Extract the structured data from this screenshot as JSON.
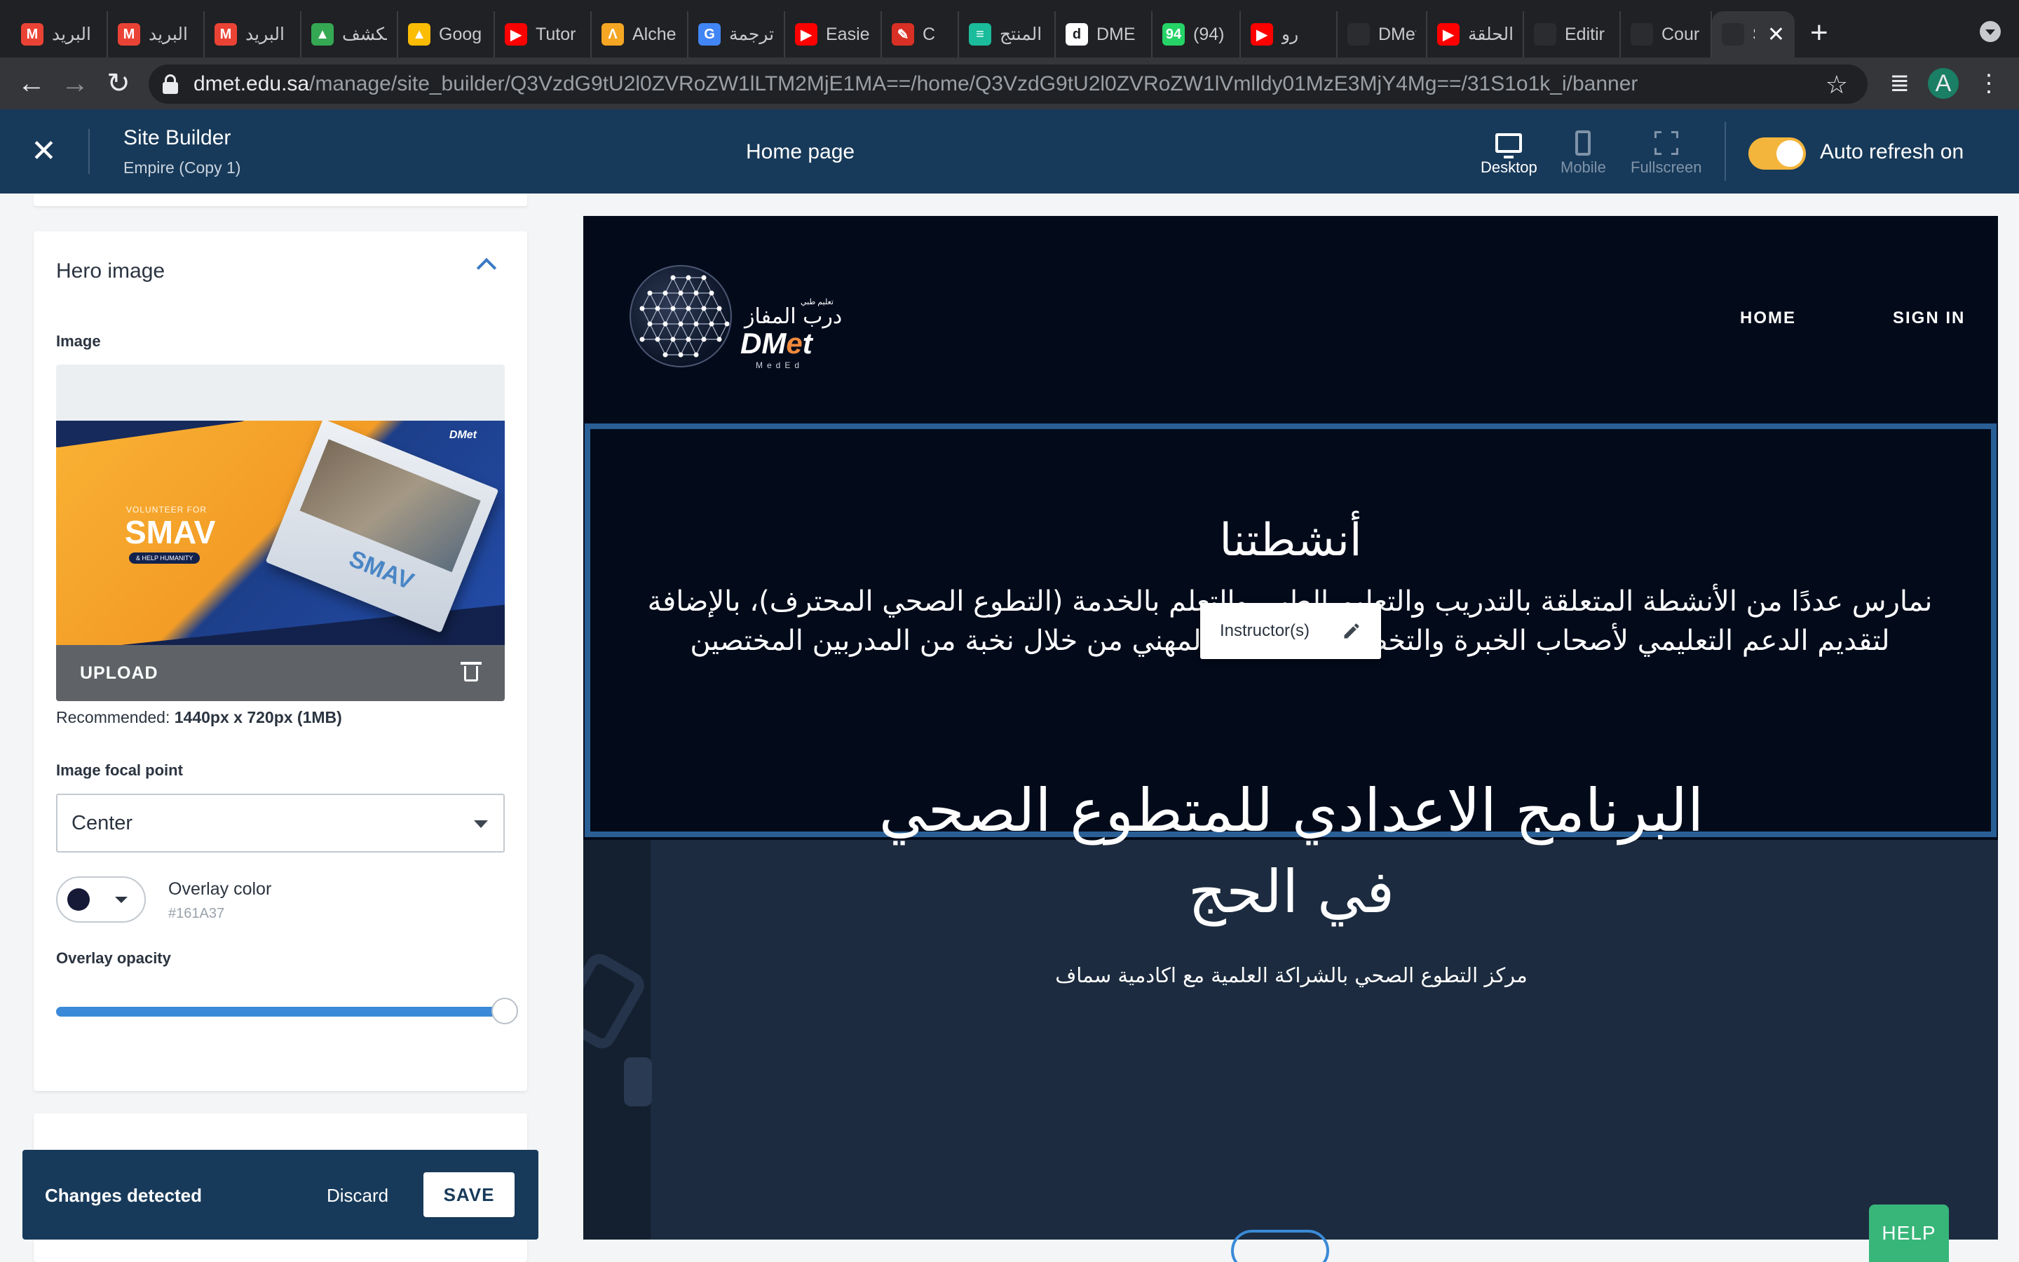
{
  "browser": {
    "tabs": [
      {
        "title": "البريد",
        "icon": "gmail-icon",
        "color": "#ea4335",
        "glyph": "M"
      },
      {
        "title": "البريد",
        "icon": "gmail-icon",
        "color": "#ea4335",
        "glyph": "M"
      },
      {
        "title": "البريد",
        "icon": "gmail-icon",
        "color": "#ea4335",
        "glyph": "M"
      },
      {
        "title": "الكشف",
        "icon": "drive-icon",
        "color": "#34a853",
        "glyph": "▲"
      },
      {
        "title": "Goog",
        "icon": "drive-icon",
        "color": "#fbbc04",
        "glyph": "▲"
      },
      {
        "title": "Tutor",
        "icon": "youtube-icon",
        "color": "#ff0000",
        "glyph": "▶"
      },
      {
        "title": "Alche",
        "icon": "alchemy-icon",
        "color": "#f5a623",
        "glyph": "Λ"
      },
      {
        "title": "ترجمة",
        "icon": "translate-icon",
        "color": "#4285f4",
        "glyph": "G"
      },
      {
        "title": "Easie",
        "icon": "youtube-icon",
        "color": "#ff0000",
        "glyph": "▶"
      },
      {
        "title": "C",
        "icon": "thumbs-up-icon",
        "color": "#d93025",
        "glyph": "✎"
      },
      {
        "title": "المنتج",
        "icon": "chat-icon",
        "color": "#1abc9c",
        "glyph": "≡"
      },
      {
        "title": "DME",
        "icon": "dmet-icon",
        "color": "#ffffff",
        "glyph": "d"
      },
      {
        "title": "(94)",
        "icon": "whatsapp-icon",
        "color": "#25d366",
        "glyph": "94"
      },
      {
        "title": "رو",
        "icon": "youtube-icon",
        "color": "#ff0000",
        "glyph": "▶"
      },
      {
        "title": "DMet",
        "icon": "site-icon",
        "color": "#2b2c30",
        "glyph": ""
      },
      {
        "title": "الحلقة",
        "icon": "youtube-icon",
        "color": "#ff0000",
        "glyph": "▶"
      },
      {
        "title": "Editir",
        "icon": "site-icon",
        "color": "#2b2c30",
        "glyph": ""
      },
      {
        "title": "Cour",
        "icon": "site-icon",
        "color": "#2b2c30",
        "glyph": ""
      },
      {
        "title": "S",
        "icon": "site-icon",
        "color": "#2b2c30",
        "glyph": "",
        "active": true
      }
    ],
    "url_host": "dmet.edu.sa",
    "url_path": "/manage/site_builder/Q3VzdG9tU2l0ZVRoZW1lLTM2MjE1MA==/home/Q3VzdG9tU2l0ZVRoZW1lVmlldy01MzE3MjY4Mg==/31S1o1k_i/banner",
    "profile_initial": "A"
  },
  "header": {
    "app_name": "Site Builder",
    "theme_name": "Empire (Copy 1)",
    "page_title": "Home page",
    "views": [
      "Desktop",
      "Mobile",
      "Fullscreen"
    ],
    "auto_refresh_label": "Auto refresh on",
    "auto_refresh_on": true,
    "accent_color": "#f4b53c",
    "bar_color": "#183a5a"
  },
  "panel": {
    "section_title": "Hero image",
    "image_label": "Image",
    "upload_label": "UPLOAD",
    "thumb": {
      "volunteer_text": "VOLUNTEER FOR",
      "big_text": "SMAV",
      "pill_text": "& HELP HUMANITY",
      "logo_text": "DMet",
      "book_text": "SMAV"
    },
    "recommended_prefix": "Recommended:",
    "recommended_value": "1440px x 720px (1MB)",
    "focal_label": "Image focal point",
    "focal_value": "Center",
    "overlay_color_label": "Overlay color",
    "overlay_color_hex": "#161A37",
    "overlay_opacity_label": "Overlay opacity",
    "overlay_opacity": 1.0
  },
  "changes_bar": {
    "message": "Changes detected",
    "discard_label": "Discard",
    "save_label": "SAVE"
  },
  "preview": {
    "logo_arabic": "درب المفاز",
    "logo_small": "تعليم طبي",
    "logo_brand_a": "DM",
    "logo_brand_o": "e",
    "logo_brand_b": "t",
    "logo_meded": "MedEd",
    "nav": [
      "HOME",
      "SIGN IN"
    ],
    "section_title": "أنشطتنا",
    "section_body": "نمارس عددًا من الأنشطة المتعلقة بالتدريب والتعليم الطبي والتعلم بالخدمة (التطوع الصحي المحترف)، بالإضافة لتقديم الدعم التعليمي لأصحاب الخبرة والتخصص، والتوجيه المهني من خلال نخبة من المدربين المختصين",
    "instructor_label": "Instructor(s)",
    "hero_title": "البرنامج الاعدادي للمتطوع الصحي في الحج",
    "hero_subtitle": "مركز التطوع الصحي بالشراكة العلمية مع اكادمية سماف"
  },
  "help_label": "HELP"
}
